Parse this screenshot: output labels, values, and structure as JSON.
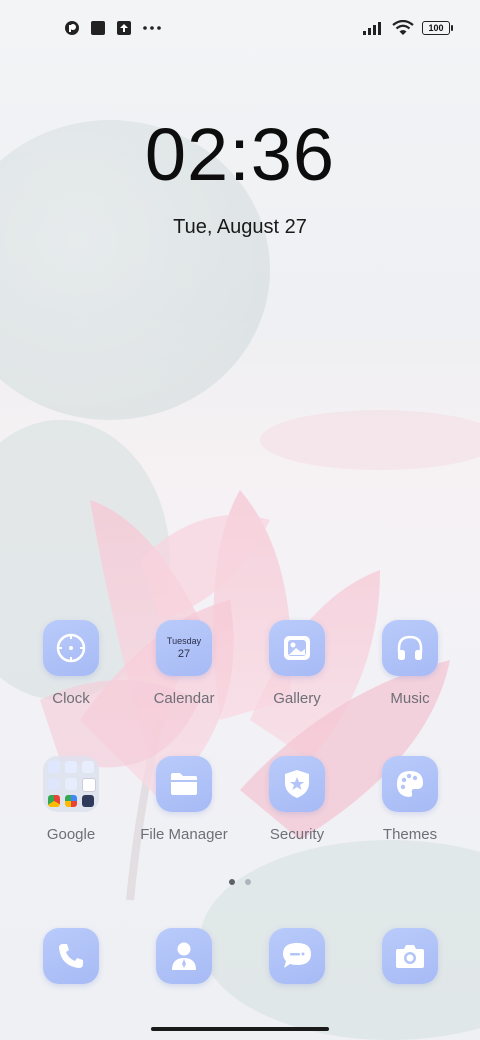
{
  "status_bar": {
    "left_icons": [
      "app-notification-icon",
      "square-notification-icon",
      "upload-notification-icon",
      "more-notifications-icon"
    ],
    "battery_level": "100",
    "signal": "signal-bars-icon",
    "wifi": "wifi-icon"
  },
  "lock": {
    "time": "02:36",
    "date": "Tue, August 27"
  },
  "apps": {
    "clock": {
      "label": "Clock",
      "icon": "clock-icon"
    },
    "calendar": {
      "label": "Calendar",
      "icon": "calendar-icon",
      "day": "Tuesday",
      "date": "27"
    },
    "gallery": {
      "label": "Gallery",
      "icon": "gallery-icon"
    },
    "music": {
      "label": "Music",
      "icon": "headphones-icon"
    },
    "google": {
      "label": "Google",
      "icon": "google-folder-icon"
    },
    "file_manager": {
      "label": "File Manager",
      "icon": "folder-icon"
    },
    "security": {
      "label": "Security",
      "icon": "shield-icon"
    },
    "themes": {
      "label": "Themes",
      "icon": "palette-icon"
    }
  },
  "page_indicator": {
    "pages": 2,
    "active": 1
  },
  "dock": [
    {
      "name": "phone",
      "icon": "phone-icon"
    },
    {
      "name": "contacts",
      "icon": "contact-icon"
    },
    {
      "name": "messages",
      "icon": "message-icon"
    },
    {
      "name": "camera",
      "icon": "camera-icon"
    }
  ],
  "colors": {
    "icon_bg": "#b0c3f8",
    "icon_fg": "#ffffff",
    "label": "#6e6f76"
  }
}
